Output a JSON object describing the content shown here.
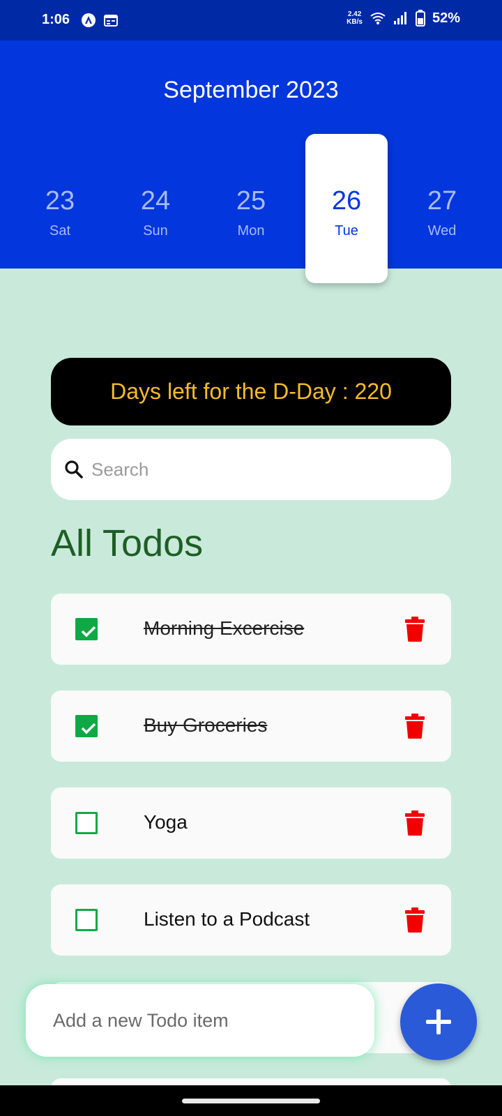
{
  "status_bar": {
    "time": "1:06",
    "net_speed_value": "2.42",
    "net_speed_unit": "KB/s",
    "battery": "52%"
  },
  "header": {
    "month": "September 2023",
    "dates": [
      {
        "num": "23",
        "day": "Sat",
        "selected": false
      },
      {
        "num": "24",
        "day": "Sun",
        "selected": false
      },
      {
        "num": "25",
        "day": "Mon",
        "selected": false
      },
      {
        "num": "26",
        "day": "Tue",
        "selected": true
      },
      {
        "num": "27",
        "day": "Wed",
        "selected": false
      }
    ]
  },
  "dday": {
    "text": "Days left for the D-Day : 220"
  },
  "search": {
    "placeholder": "Search",
    "icon": "search-icon"
  },
  "section": {
    "title": "All Todos"
  },
  "todos": [
    {
      "label": "Morning Excercise",
      "done": true
    },
    {
      "label": "Buy Groceries",
      "done": true
    },
    {
      "label": "Yoga",
      "done": false
    },
    {
      "label": "Listen to a Podcast",
      "done": false
    }
  ],
  "add": {
    "placeholder": "Add a new Todo item",
    "button_icon": "plus-icon"
  },
  "colors": {
    "header": "#0336dc",
    "status_bar": "#0029a6",
    "background": "#c9eadb",
    "dday_text": "#f5bd2a",
    "check_green": "#0fa844",
    "trash_red": "#f20000",
    "title_green": "#1e5e25",
    "fab": "#2a5ad8"
  }
}
